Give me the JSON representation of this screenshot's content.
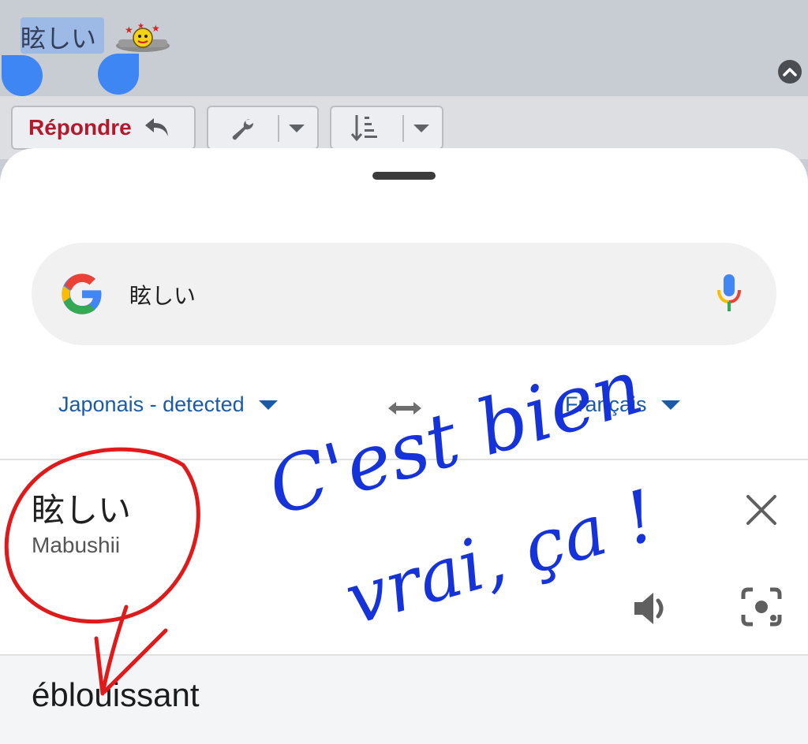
{
  "selection": {
    "text": "眩しい"
  },
  "toolbar": {
    "reply_label": "Répondre"
  },
  "search": {
    "query": "眩しい"
  },
  "languages": {
    "source": "Japonais - detected",
    "target": "Français"
  },
  "source_card": {
    "text": "眩しい",
    "romanization": "Mabushii"
  },
  "target_card": {
    "translation": "éblouissant"
  },
  "annotation": {
    "line1": "C'est bien",
    "line2": "vrai, ça !"
  },
  "colors": {
    "reply": "#b01a2c",
    "link_blue": "#1a5aa8",
    "ink_blue": "#1533d8",
    "ink_red": "#e01a1a",
    "handle": "#3d86f3"
  },
  "icons": [
    "reply-arrow-icon",
    "wrench-icon",
    "sort-icon",
    "chevron-down-icon",
    "chevron-up-icon",
    "google-logo-icon",
    "mic-icon",
    "swap-icon",
    "close-icon",
    "speaker-icon",
    "lens-icon",
    "smiley-icon"
  ]
}
